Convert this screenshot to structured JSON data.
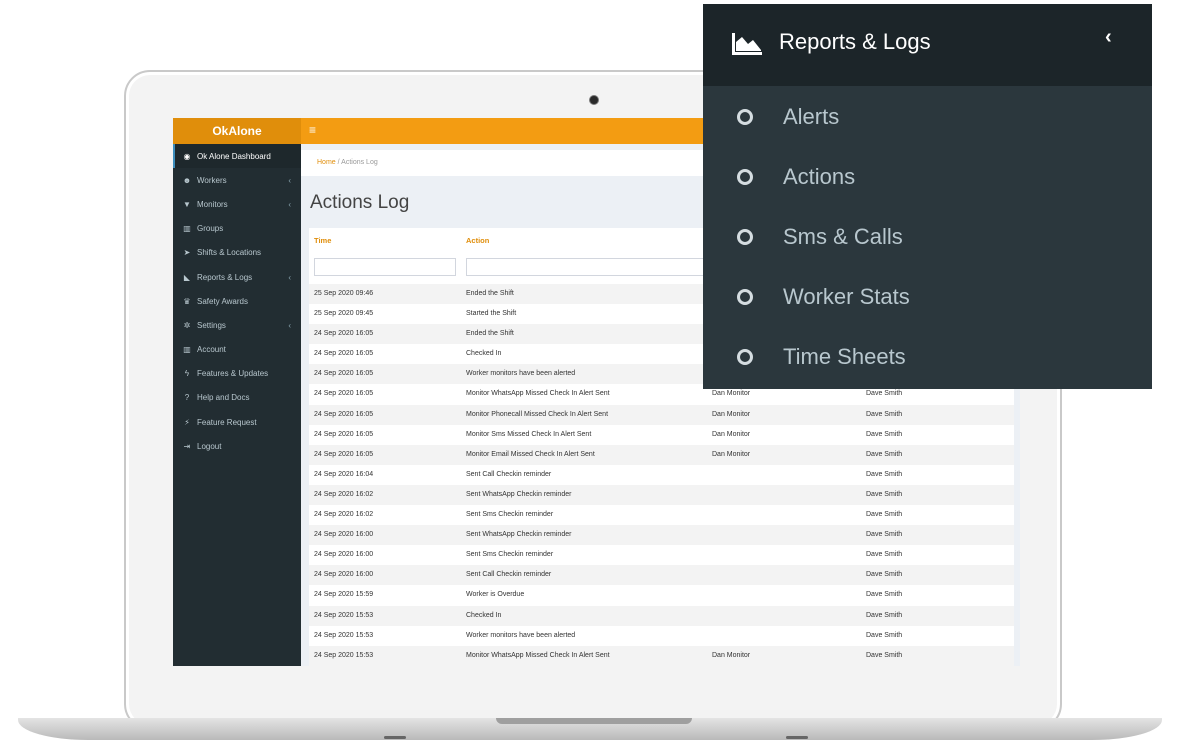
{
  "app": {
    "brand": "OkAlone",
    "hamburger": "≡"
  },
  "sidebar": {
    "items": [
      {
        "label": "Ok Alone Dashboard",
        "icon": "tachometer-icon",
        "glyph": "◉",
        "chevron": false,
        "active": true
      },
      {
        "label": "Workers",
        "icon": "users-icon",
        "glyph": "☻",
        "chevron": true
      },
      {
        "label": "Monitors",
        "icon": "shield-icon",
        "glyph": "▼",
        "chevron": true
      },
      {
        "label": "Groups",
        "icon": "building-icon",
        "glyph": "▥",
        "chevron": false
      },
      {
        "label": "Shifts & Locations",
        "icon": "location-arrow-icon",
        "glyph": "➤",
        "chevron": false
      },
      {
        "label": "Reports & Logs",
        "icon": "area-chart-icon",
        "glyph": "◣",
        "chevron": true
      },
      {
        "label": "Safety Awards",
        "icon": "trophy-icon",
        "glyph": "♛",
        "chevron": false
      },
      {
        "label": "Settings",
        "icon": "cogs-icon",
        "glyph": "✲",
        "chevron": true
      },
      {
        "label": "Account",
        "icon": "bank-icon",
        "glyph": "▥",
        "chevron": false
      },
      {
        "label": "Features & Updates",
        "icon": "bolt-icon",
        "glyph": "ϟ",
        "chevron": false
      },
      {
        "label": "Help and Docs",
        "icon": "question-circle-icon",
        "glyph": "?",
        "chevron": false
      },
      {
        "label": "Feature Request",
        "icon": "magic-icon",
        "glyph": "⚡",
        "chevron": false
      },
      {
        "label": "Logout",
        "icon": "sign-out-icon",
        "glyph": "⇥",
        "chevron": false
      }
    ],
    "chevron_glyph": "‹"
  },
  "breadcrumb": {
    "home": "Home",
    "separator": "/",
    "current": "Actions Log"
  },
  "page": {
    "title": "Actions Log"
  },
  "table": {
    "columns": [
      "Time",
      "Action"
    ],
    "rows": [
      {
        "time": "25 Sep 2020 09:46",
        "action": "Ended the Shift",
        "monitor": "",
        "worker": ""
      },
      {
        "time": "25 Sep 2020 09:45",
        "action": "Started the Shift",
        "monitor": "",
        "worker": ""
      },
      {
        "time": "24 Sep 2020 16:05",
        "action": "Ended the Shift",
        "monitor": "",
        "worker": ""
      },
      {
        "time": "24 Sep 2020 16:05",
        "action": "Checked In",
        "monitor": "",
        "worker": ""
      },
      {
        "time": "24 Sep 2020 16:05",
        "action": "Worker monitors have been alerted",
        "monitor": "",
        "worker": ""
      },
      {
        "time": "24 Sep 2020 16:05",
        "action": "Monitor WhatsApp Missed Check In Alert Sent",
        "monitor": "Dan Monitor",
        "worker": "Dave Smith"
      },
      {
        "time": "24 Sep 2020 16:05",
        "action": "Monitor Phonecall Missed Check In Alert Sent",
        "monitor": "Dan Monitor",
        "worker": "Dave Smith"
      },
      {
        "time": "24 Sep 2020 16:05",
        "action": "Monitor Sms Missed Check In Alert Sent",
        "monitor": "Dan Monitor",
        "worker": "Dave Smith"
      },
      {
        "time": "24 Sep 2020 16:05",
        "action": "Monitor Email Missed Check In Alert Sent",
        "monitor": "Dan Monitor",
        "worker": "Dave Smith"
      },
      {
        "time": "24 Sep 2020 16:04",
        "action": "Sent Call Checkin reminder",
        "monitor": "",
        "worker": "Dave Smith"
      },
      {
        "time": "24 Sep 2020 16:02",
        "action": "Sent WhatsApp Checkin reminder",
        "monitor": "",
        "worker": "Dave Smith"
      },
      {
        "time": "24 Sep 2020 16:02",
        "action": "Sent Sms Checkin reminder",
        "monitor": "",
        "worker": "Dave Smith"
      },
      {
        "time": "24 Sep 2020 16:00",
        "action": "Sent WhatsApp Checkin reminder",
        "monitor": "",
        "worker": "Dave Smith"
      },
      {
        "time": "24 Sep 2020 16:00",
        "action": "Sent Sms Checkin reminder",
        "monitor": "",
        "worker": "Dave Smith"
      },
      {
        "time": "24 Sep 2020 16:00",
        "action": "Sent Call Checkin reminder",
        "monitor": "",
        "worker": "Dave Smith"
      },
      {
        "time": "24 Sep 2020 15:59",
        "action": "Worker is Overdue",
        "monitor": "",
        "worker": "Dave Smith"
      },
      {
        "time": "24 Sep 2020 15:53",
        "action": "Checked In",
        "monitor": "",
        "worker": "Dave Smith"
      },
      {
        "time": "24 Sep 2020 15:53",
        "action": "Worker monitors have been alerted",
        "monitor": "",
        "worker": "Dave Smith"
      },
      {
        "time": "24 Sep 2020 15:53",
        "action": "Monitor WhatsApp Missed Check In Alert Sent",
        "monitor": "Dan Monitor",
        "worker": "Dave Smith"
      }
    ]
  },
  "popup": {
    "title": "Reports & Logs",
    "back_glyph": "‹",
    "items": [
      "Alerts",
      "Actions",
      "Sms & Calls",
      "Worker Stats",
      "Time Sheets"
    ]
  },
  "colors": {
    "accent": "#f39c12",
    "brand_bar": "#e08e0b",
    "sidebar": "#222d32",
    "popup_bg": "#2b373d"
  }
}
